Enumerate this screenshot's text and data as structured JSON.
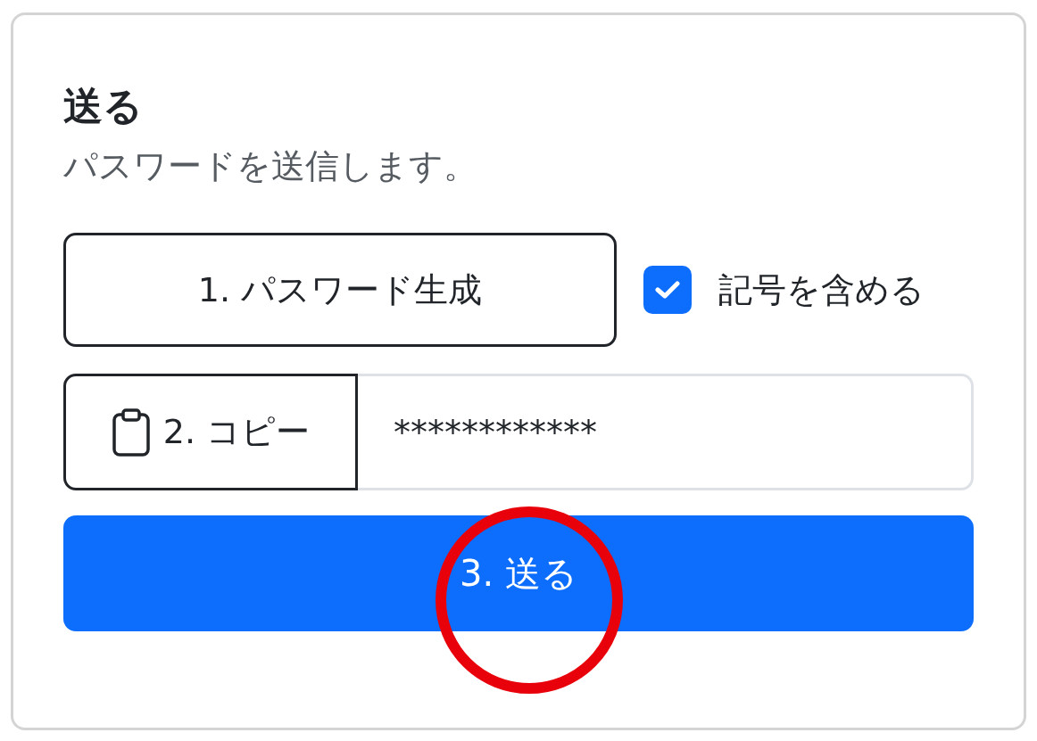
{
  "card": {
    "title": "送る",
    "subtitle": "パスワードを送信します。"
  },
  "generate_button": {
    "label": "1. パスワード生成"
  },
  "symbols_checkbox": {
    "label": "記号を含める",
    "checked": true
  },
  "copy_button": {
    "label": "2. コピー"
  },
  "password_field": {
    "value": "************"
  },
  "send_button": {
    "label": "3. 送る"
  }
}
